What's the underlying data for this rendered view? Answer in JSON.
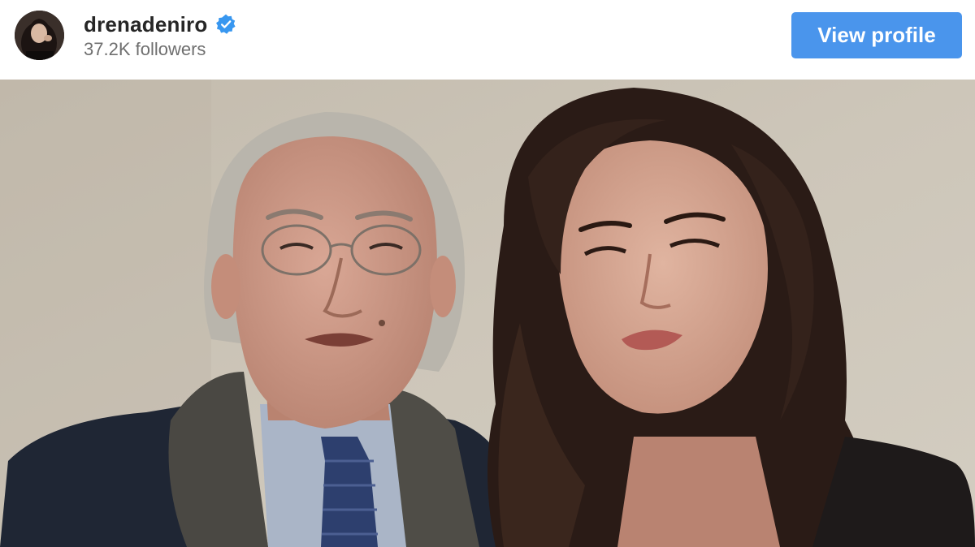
{
  "profile": {
    "username": "drenadeniro",
    "verified": true,
    "followers_text": "37.2K followers",
    "avatar_icon": "avatar-photo"
  },
  "actions": {
    "view_profile_label": "View profile"
  },
  "colors": {
    "button_bg": "#4a95ec",
    "button_text": "#ffffff",
    "username_text": "#262626",
    "followers_text": "#6f6f6f",
    "verified_badge": "#3897f0"
  },
  "post": {
    "image_icon": "post-photo"
  }
}
